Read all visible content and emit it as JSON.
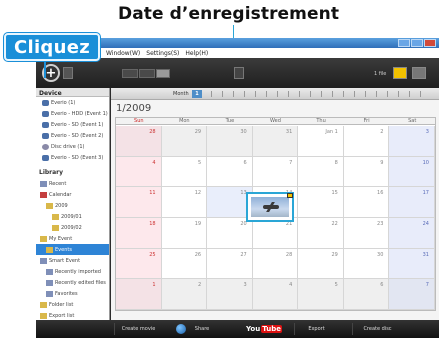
{
  "annotations": {
    "title": "Date d’enregistrement",
    "button_callout": "Cliquez"
  },
  "menu": [
    "Window(W)",
    "Settings(S)",
    "Help(H)"
  ],
  "toolbar": {
    "add_button_label": "+",
    "view_buttons": [
      "",
      "",
      ""
    ],
    "right_label": "1 file"
  },
  "sidebar": {
    "device_header": "Device",
    "devices": [
      "Everio (1)",
      "Everio - HDD (Event 1)",
      "Everio - SD (Event 1)",
      "Everio - SD (Event 2)",
      "Disc drive (1)",
      "Everio - SD (Event 3)"
    ],
    "library_header": "Library",
    "library": [
      {
        "label": "Recent",
        "icon": "clock-icon",
        "indent": 0
      },
      {
        "label": "Calendar",
        "icon": "calendar-icon",
        "indent": 0
      },
      {
        "label": "2009",
        "icon": "folder-icon",
        "indent": 1
      },
      {
        "label": "2009/01",
        "icon": "folder-icon",
        "indent": 2
      },
      {
        "label": "2009/02",
        "icon": "folder-icon",
        "indent": 2
      },
      {
        "label": "My Event",
        "icon": "folder-icon",
        "indent": 0
      },
      {
        "label": "Events",
        "icon": "folder-icon",
        "indent": 1,
        "selected": true
      },
      {
        "label": "Smart Event",
        "icon": "smart-icon",
        "indent": 0
      },
      {
        "label": "Recently imported",
        "icon": "smart-icon",
        "indent": 1
      },
      {
        "label": "Recently edited files",
        "icon": "smart-icon",
        "indent": 1
      },
      {
        "label": "Favorites",
        "icon": "smart-icon",
        "indent": 1
      },
      {
        "label": "Folder list",
        "icon": "folder-icon",
        "indent": 0
      },
      {
        "label": "Export list",
        "icon": "folder-icon",
        "indent": 0
      }
    ]
  },
  "calendar": {
    "mode_label": "Month",
    "mode_value": "1",
    "month_title": "1/2009",
    "weekdays": [
      "Sun",
      "Mon",
      "Tue",
      "Wed",
      "Thu",
      "Fri",
      "Sat"
    ],
    "weeks": [
      [
        "28",
        "29",
        "30",
        "31",
        "Jan 1",
        "2",
        "3"
      ],
      [
        "4",
        "5",
        "6",
        "7",
        "8",
        "9",
        "10"
      ],
      [
        "11",
        "12",
        "13",
        "14",
        "15",
        "16",
        "17"
      ],
      [
        "18",
        "19",
        "20",
        "21",
        "22",
        "23",
        "24"
      ],
      [
        "25",
        "26",
        "27",
        "28",
        "29",
        "30",
        "31"
      ],
      [
        "1",
        "2",
        "3",
        "4",
        "5",
        "6",
        "7"
      ]
    ],
    "thumbnail_icon": "airplane-video-thumbnail"
  },
  "bottombar": {
    "buttons": [
      "Create movie",
      "Share",
      "Export",
      "Create disc"
    ],
    "share_icon": "globe-icon",
    "youtube_you": "You",
    "youtube_tube": "Tube"
  },
  "colors": {
    "callout_blue": "#1a8fd8",
    "selection_blue": "#2e84d6",
    "sunday_bg": "#fde8ec",
    "saturday_bg": "#e8ecfa"
  }
}
